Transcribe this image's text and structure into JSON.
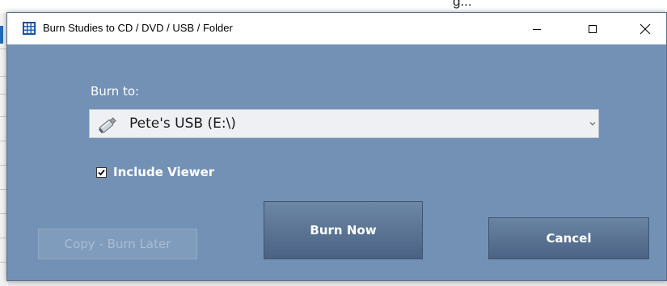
{
  "background": {
    "partial_text": "g... "
  },
  "window": {
    "title": "Burn Studies to CD / DVD / USB / Folder",
    "controls": {
      "minimize": "minimize-icon",
      "maximize": "maximize-icon",
      "close": "close-icon"
    }
  },
  "form": {
    "burn_to_label": "Burn to:",
    "destination": {
      "selected": "Pete's USB (E:\\)",
      "icon": "usb-drive-icon"
    },
    "include_viewer": {
      "label": "Include Viewer",
      "checked": true
    }
  },
  "buttons": {
    "copy_burn_later": "Copy - Burn Later",
    "burn_now": "Burn Now",
    "cancel": "Cancel"
  },
  "colors": {
    "window_bg": "#7391b4",
    "button_dark": "#4a6283",
    "disabled_text": "#a9bdd4"
  }
}
